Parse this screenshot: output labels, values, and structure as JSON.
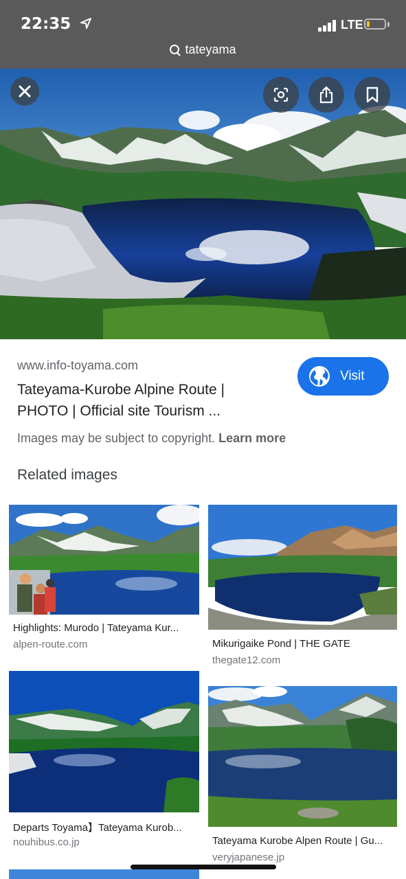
{
  "status": {
    "time": "22:35",
    "network": "LTE",
    "address": "tateyama"
  },
  "toolbar": {
    "close_icon": "close-icon",
    "lens_icon": "google-lens-icon",
    "share_icon": "share-icon",
    "bookmark_icon": "bookmark-icon"
  },
  "result": {
    "domain": "www.info-toyama.com",
    "title": "Tateyama-Kurobe Alpine Route | PHOTO | Official site Tourism ...",
    "visit_label": "Visit",
    "copyright_text": "Images may be subject to copyright.",
    "learn_more": "Learn more"
  },
  "related": {
    "heading": "Related images",
    "items": [
      {
        "caption": "Highlights: Murodo | Tateyama Kur...",
        "domain": "alpen-route.com"
      },
      {
        "caption": "Mikurigaike Pond | THE GATE",
        "domain": "thegate12.com"
      },
      {
        "caption": "Departs Toyama】Tateyama Kurob...",
        "domain": "nouhibus.co.jp"
      },
      {
        "caption": "Tateyama Kurobe Alpen Route | Gu...",
        "domain": "veryjapanese.jp"
      }
    ]
  },
  "colors": {
    "accent": "#1a73e8",
    "status_bar": "#5a5a5a"
  }
}
